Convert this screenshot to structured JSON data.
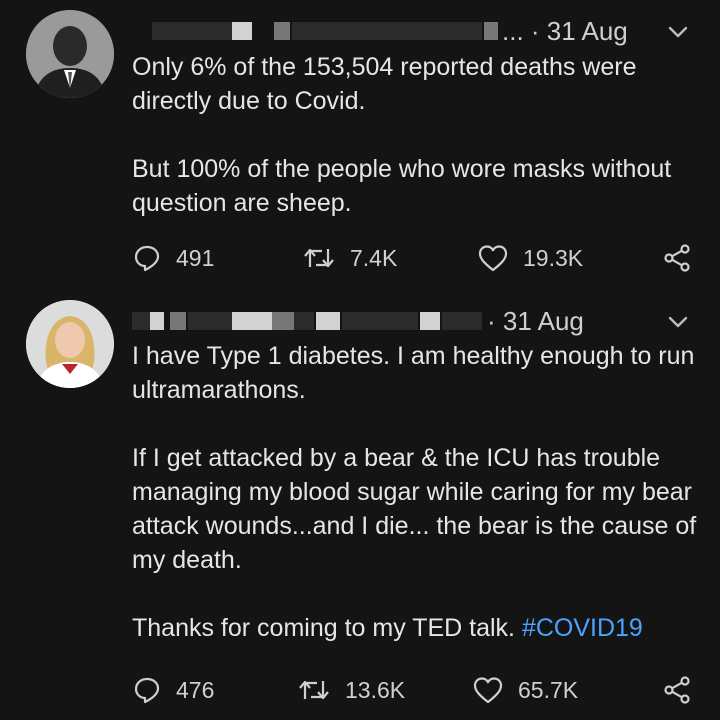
{
  "tweets": [
    {
      "author_visible_suffix": "...",
      "date": "31 Aug",
      "paragraphs": [
        "Only 6% of the 153,504 reported deaths were directly due to Covid.",
        "But 100% of the people who wore masks without question are sheep."
      ],
      "stats": {
        "replies": "491",
        "retweets": "7.4K",
        "likes": "19.3K"
      }
    },
    {
      "date": "31 Aug",
      "paragraphs": [
        "I have Type 1 diabetes. I am healthy enough to run ultramarathons.",
        "If I get attacked by a bear & the ICU has trouble managing my blood sugar while caring for my bear attack wounds...and I die... the bear is the cause of my death."
      ],
      "last_paragraph_text": "Thanks for coming to my TED talk. ",
      "hashtag": "#COVID19",
      "stats": {
        "replies": "476",
        "retweets": "13.6K",
        "likes": "65.7K"
      }
    }
  ],
  "icons": {
    "reply": "reply-icon",
    "retweet": "retweet-icon",
    "like": "heart-icon",
    "share": "share-icon",
    "menu": "chevron-down-icon"
  },
  "colors": {
    "background": "#141414",
    "text": "#e6e6e6",
    "secondary": "#cfcfcf",
    "link": "#4aa3ff"
  }
}
